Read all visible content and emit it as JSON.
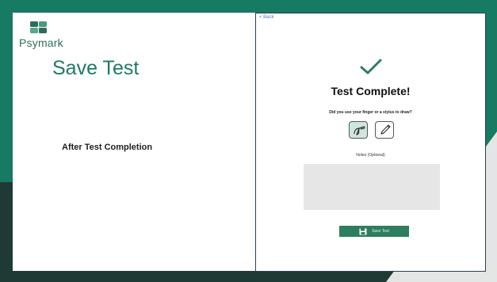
{
  "logo": {
    "text": "Psymark"
  },
  "slide": {
    "title": "Save Test",
    "subtitle": "After Test Completion"
  },
  "screenshot": {
    "back_label": "< Back",
    "heading": "Test Complete!",
    "question": "Did you use your finger or a stylus to draw?",
    "notes_label": "Notes (Optional)",
    "notes_value": "",
    "save_button_label": "Save Test",
    "accent_color": "#2e7d5f"
  }
}
